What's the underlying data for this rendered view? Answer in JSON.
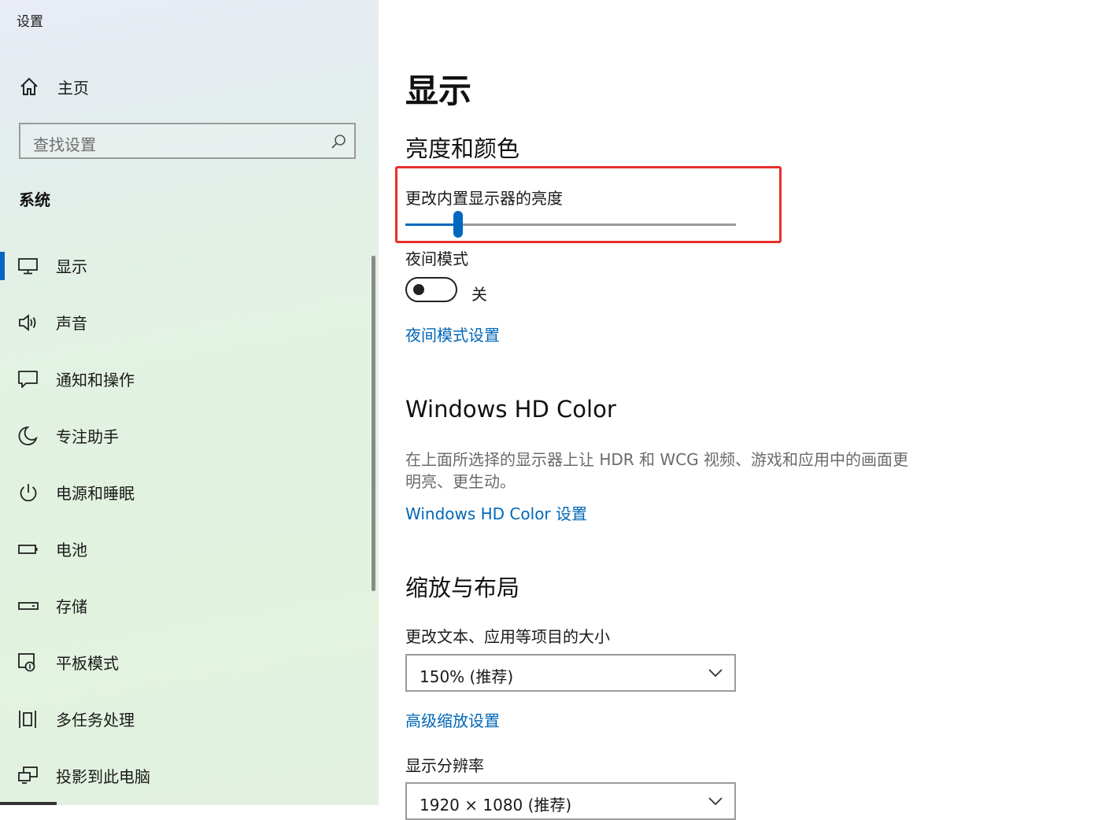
{
  "window": {
    "title": "设置"
  },
  "sidebar": {
    "home_label": "主页",
    "search_placeholder": "查找设置",
    "section_label": "系统",
    "items": [
      {
        "label": "显示",
        "icon": "monitor-icon",
        "active": true
      },
      {
        "label": "声音",
        "icon": "speaker-icon"
      },
      {
        "label": "通知和操作",
        "icon": "message-icon"
      },
      {
        "label": "专注助手",
        "icon": "moon-icon"
      },
      {
        "label": "电源和睡眠",
        "icon": "power-icon"
      },
      {
        "label": "电池",
        "icon": "battery-icon"
      },
      {
        "label": "存储",
        "icon": "storage-icon"
      },
      {
        "label": "平板模式",
        "icon": "tablet-mode-icon"
      },
      {
        "label": "多任务处理",
        "icon": "multitask-icon"
      },
      {
        "label": "投影到此电脑",
        "icon": "project-icon"
      }
    ]
  },
  "main": {
    "title": "显示",
    "brightness_section": "亮度和颜色",
    "brightness_label": "更改内置显示器的亮度",
    "brightness_value": 0.16,
    "night_light_label": "夜间模式",
    "night_light_state": "关",
    "night_light_link": "夜间模式设置",
    "hdr_title": "Windows HD Color",
    "hdr_desc_line1": "在上面所选择的显示器上让 HDR 和 WCG 视频、游戏和应用中的画面更",
    "hdr_desc_line2": "明亮、更生动。",
    "hdr_link": "Windows HD Color 设置",
    "scale_section": "缩放与布局",
    "scale_label": "更改文本、应用等项目的大小",
    "scale_value": "150% (推荐)",
    "advanced_scale_link": "高级缩放设置",
    "resolution_label": "显示分辨率",
    "resolution_value": "1920 × 1080 (推荐)"
  },
  "colors": {
    "accent": "#0067c0",
    "link": "#0067b8",
    "highlight": "#e8302c"
  }
}
